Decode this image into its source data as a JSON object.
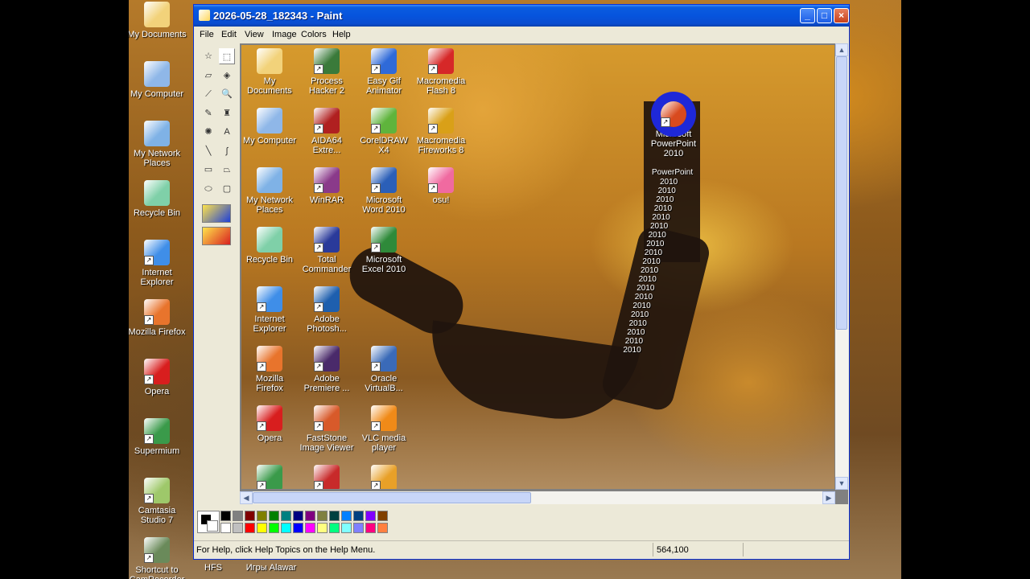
{
  "desktop": {
    "icons": [
      {
        "label": "My Documents",
        "color": "#f2d27a"
      },
      {
        "label": "My Computer",
        "color": "#8fb7e8"
      },
      {
        "label": "My Network Places",
        "color": "#7fb2e6"
      },
      {
        "label": "Recycle Bin",
        "color": "#7fd0a8"
      },
      {
        "label": "Internet Explorer",
        "color": "#3f8ee8"
      },
      {
        "label": "Mozilla Firefox",
        "color": "#e8742c"
      },
      {
        "label": "Opera",
        "color": "#d81e1e"
      },
      {
        "label": "Supermium",
        "color": "#3a9a4a"
      },
      {
        "label": "Camtasia Studio 7",
        "color": "#9ec86a"
      },
      {
        "label": "Shortcut to CamRecorder",
        "color": "#6a8a5a"
      }
    ],
    "bottom_labels": [
      "HFS",
      "Игры Alawar"
    ]
  },
  "window": {
    "title": "2026-05-28_182343 - Paint",
    "buttons": {
      "minimize": "_",
      "maximize": "□",
      "close": "×"
    },
    "menu": [
      "File",
      "Edit",
      "View",
      "Image",
      "Colors",
      "Help"
    ]
  },
  "tools": [
    {
      "name": "free-form-select-tool",
      "glyph": "☆"
    },
    {
      "name": "select-tool",
      "glyph": "⬚"
    },
    {
      "name": "eraser-tool",
      "glyph": "▱"
    },
    {
      "name": "fill-with-color-tool",
      "glyph": "◈"
    },
    {
      "name": "pick-color-tool",
      "glyph": "⟋"
    },
    {
      "name": "magnifier-tool",
      "glyph": "🔍"
    },
    {
      "name": "pencil-tool",
      "glyph": "✎"
    },
    {
      "name": "brush-tool",
      "glyph": "♜"
    },
    {
      "name": "airbrush-tool",
      "glyph": "✺"
    },
    {
      "name": "text-tool",
      "glyph": "A"
    },
    {
      "name": "line-tool",
      "glyph": "╲"
    },
    {
      "name": "curve-tool",
      "glyph": "∫"
    },
    {
      "name": "rectangle-tool",
      "glyph": "▭"
    },
    {
      "name": "polygon-tool",
      "glyph": "⏢"
    },
    {
      "name": "ellipse-tool",
      "glyph": "⬭"
    },
    {
      "name": "rounded-rectangle-tool",
      "glyph": "▢"
    }
  ],
  "canvas": {
    "icons": [
      {
        "label": "My Documents",
        "color": "#f2d27a"
      },
      {
        "label": "Process Hacker 2",
        "color": "#3a7a3a"
      },
      {
        "label": "Easy Gif Animator",
        "color": "#2f6ad8"
      },
      {
        "label": "Macromedia Flash 8",
        "color": "#d62828"
      },
      {
        "label": "My Computer",
        "color": "#8fb7e8"
      },
      {
        "label": "AIDA64 Extre...",
        "color": "#b02020"
      },
      {
        "label": "CorelDRAW X4",
        "color": "#5fb43c"
      },
      {
        "label": "Macromedia Fireworks 8",
        "color": "#d9a018"
      },
      {
        "label": "My Network Places",
        "color": "#7fb2e6"
      },
      {
        "label": "WinRAR",
        "color": "#8a3a8a"
      },
      {
        "label": "Microsoft Word 2010",
        "color": "#2b5fb8"
      },
      {
        "label": "osu!",
        "color": "#f06aa0"
      },
      {
        "label": "Recycle Bin",
        "color": "#7fd0a8"
      },
      {
        "label": "Total Commander",
        "color": "#2a3a9a"
      },
      {
        "label": "Microsoft Excel 2010",
        "color": "#2f8a3a"
      },
      {
        "label": "Internet Explorer",
        "color": "#3f8ee8"
      },
      {
        "label": "Adobe Photosh...",
        "color": "#1e5fae"
      },
      {
        "label": "Mozilla Firefox",
        "color": "#e8742c"
      },
      {
        "label": "Adobe Premiere ...",
        "color": "#4a2a6a"
      },
      {
        "label": "Oracle VirtualB...",
        "color": "#3a6ab8"
      },
      {
        "label": "Opera",
        "color": "#d81e1e"
      },
      {
        "label": "FastStone Image Viewer",
        "color": "#d85a2a"
      },
      {
        "label": "VLC media player",
        "color": "#f08a18"
      },
      {
        "label": "",
        "color": "#3a9a4a"
      },
      {
        "label": "",
        "color": "#c82a2a"
      },
      {
        "label": "",
        "color": "#e8a028"
      }
    ],
    "dragged_icon": {
      "label": "Microsoft PowerPoint 2010",
      "color": "#d84a1e",
      "highlight": "#1e28d8"
    },
    "trail_label": "2010",
    "trail_label_extra": "PowerPoint"
  },
  "palette": {
    "foreground": "#000000",
    "background": "#ffffff",
    "top_row": [
      "#000000",
      "#808080",
      "#800000",
      "#808000",
      "#008000",
      "#008080",
      "#000080",
      "#800080",
      "#808040",
      "#004040",
      "#0080ff",
      "#004080",
      "#8000ff",
      "#804000"
    ],
    "bottom_row": [
      "#ffffff",
      "#c0c0c0",
      "#ff0000",
      "#ffff00",
      "#00ff00",
      "#00ffff",
      "#0000ff",
      "#ff00ff",
      "#ffff80",
      "#00ff80",
      "#80ffff",
      "#8080ff",
      "#ff0080",
      "#ff8040"
    ]
  },
  "status": {
    "help_text": "For Help, click Help Topics on the Help Menu.",
    "coordinates": "564,100"
  }
}
